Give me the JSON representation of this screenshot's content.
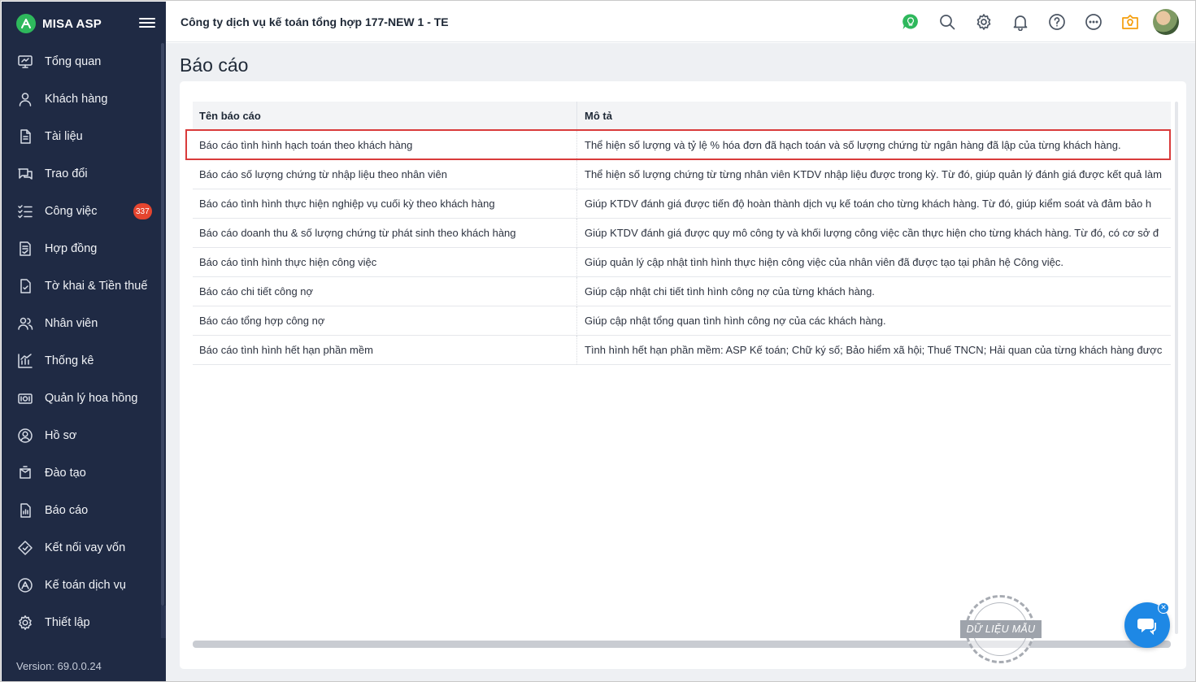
{
  "brand": {
    "name": "MISA ASP"
  },
  "header": {
    "company": "Công ty dịch vụ kế toán tổng hợp 177-NEW 1 - TE",
    "icons": [
      "idea-icon",
      "search-icon",
      "settings-icon",
      "bell-icon",
      "help-icon",
      "more-icon",
      "news-icon"
    ]
  },
  "sidebar": {
    "items": [
      {
        "label": "Tổng quan",
        "icon": "dashboard-icon"
      },
      {
        "label": "Khách hàng",
        "icon": "user-icon"
      },
      {
        "label": "Tài liệu",
        "icon": "document-icon"
      },
      {
        "label": "Trao đổi",
        "icon": "chat-icon"
      },
      {
        "label": "Công việc",
        "icon": "tasks-icon",
        "badge": "337"
      },
      {
        "label": "Hợp đồng",
        "icon": "contract-icon"
      },
      {
        "label": "Tờ khai & Tiền thuế",
        "icon": "tax-icon"
      },
      {
        "label": "Nhân viên",
        "icon": "staff-icon"
      },
      {
        "label": "Thống kê",
        "icon": "stats-icon"
      },
      {
        "label": "Quản lý hoa hồng",
        "icon": "commission-icon"
      },
      {
        "label": "Hồ sơ",
        "icon": "profile-icon"
      },
      {
        "label": "Đào tạo",
        "icon": "training-icon"
      },
      {
        "label": "Báo cáo",
        "icon": "report-icon"
      },
      {
        "label": "Kết nối vay vốn",
        "icon": "loan-icon"
      },
      {
        "label": "Kế toán dịch vụ",
        "icon": "accounting-icon"
      },
      {
        "label": "Thiết lập",
        "icon": "settings-icon"
      }
    ],
    "version": "Version: 69.0.0.24"
  },
  "main": {
    "title": "Báo cáo",
    "table": {
      "headers": {
        "name": "Tên báo cáo",
        "desc": "Mô tả"
      },
      "rows": [
        {
          "name": "Báo cáo tình hình hạch toán theo khách hàng",
          "desc": "Thể hiện số lượng và tỷ lệ % hóa đơn đã hạch toán và số lượng chứng từ ngân hàng đã lập của từng khách hàng."
        },
        {
          "name": "Báo cáo số lượng chứng từ nhập liệu theo nhân viên",
          "desc": "Thể hiện số lượng chứng từ từng nhân viên KTDV nhập liệu được trong kỳ. Từ đó, giúp quản lý đánh giá được kết quả làm"
        },
        {
          "name": "Báo cáo tình hình thực hiện nghiệp vụ cuối kỳ theo khách hàng",
          "desc": "Giúp KTDV đánh giá được tiến độ hoàn thành dịch vụ kế toán cho từng khách hàng. Từ đó, giúp kiểm soát và đảm bảo h"
        },
        {
          "name": "Báo cáo doanh thu & số lượng chứng từ phát sinh theo khách hàng",
          "desc": "Giúp KTDV đánh giá được quy mô công ty và khối lượng công việc cần thực hiện cho từng khách hàng. Từ đó, có cơ sở đ"
        },
        {
          "name": "Báo cáo tình hình thực hiện công việc",
          "desc": "Giúp quản lý cập nhật tình hình thực hiện công việc của nhân viên đã được tạo tại phân hệ Công việc."
        },
        {
          "name": "Báo cáo chi tiết công nợ",
          "desc": "Giúp cập nhật chi tiết tình hình công nợ của từng khách hàng."
        },
        {
          "name": "Báo cáo tổng hợp công nợ",
          "desc": "Giúp cập nhật tổng quan tình hình công nợ của các khách hàng."
        },
        {
          "name": "Báo cáo tình hình hết hạn phần mềm",
          "desc": "Tình hình hết hạn phần mềm: ASP Kế toán; Chữ ký số; Bảo hiểm xã hội; Thuế TNCN; Hải quan của từng khách hàng được"
        }
      ]
    }
  },
  "stamp": {
    "text": "DỮ LIỆU MẪU"
  },
  "colors": {
    "sidebar": "#1f2a44",
    "brand": "#2eb85c",
    "badge": "#e5452f",
    "highlight": "#d93b3b",
    "chat": "#1e88e5"
  }
}
